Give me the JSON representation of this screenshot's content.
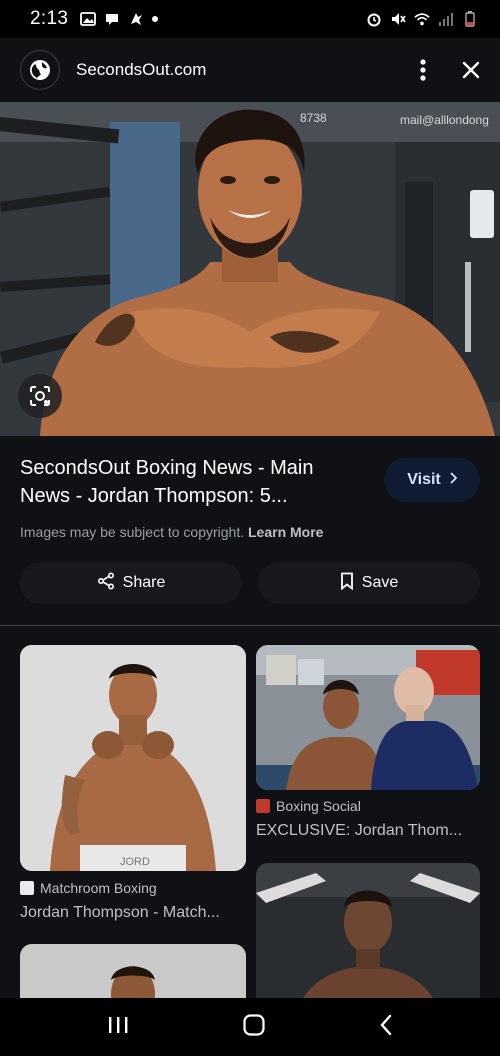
{
  "status_bar": {
    "time": "2:13"
  },
  "top_bar": {
    "site_name": "SecondsOut.com"
  },
  "hero": {
    "background_text_1": "8738",
    "background_text_2": "mail@alllondong"
  },
  "result": {
    "title_line1": "SecondsOut Boxing News - Main",
    "title_line2": "News - Jordan Thompson: 5...",
    "visit_label": "Visit",
    "copyright_text": "Images may be subject to copyright.",
    "learn_more": "Learn More",
    "share_label": "Share",
    "save_label": "Save"
  },
  "related": [
    {
      "source": "Matchroom Boxing",
      "caption": "Jordan Thompson - Match...",
      "shorts_text": "JORD"
    },
    {
      "source": "Boxing Social",
      "caption": "EXCLUSIVE: Jordan Thom..."
    },
    {
      "source": "",
      "caption": ""
    },
    {
      "source": "",
      "caption": ""
    }
  ],
  "colors": {
    "accent": "#d2e3fc",
    "visit_bg": "#0e1b30",
    "surface": "#0f1114"
  }
}
